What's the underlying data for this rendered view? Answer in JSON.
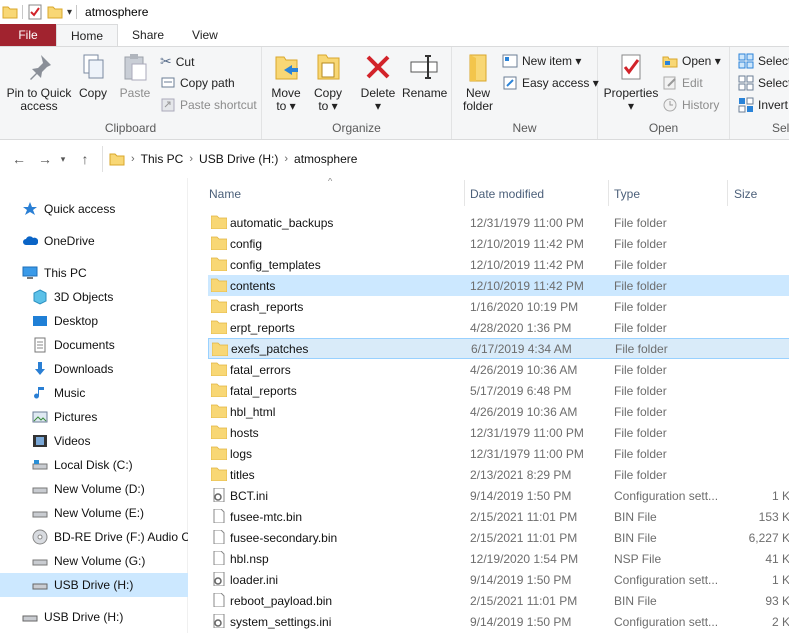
{
  "window": {
    "title": "atmosphere"
  },
  "tabs": [
    "File",
    "Home",
    "Share",
    "View"
  ],
  "ribbon": {
    "clipboard": {
      "label": "Clipboard",
      "pin": "Pin to Quick access",
      "pin_l1": "Pin to Quick",
      "pin_l2": "access",
      "copy": "Copy",
      "paste": "Paste",
      "cut": "Cut",
      "copy_path": "Copy path",
      "paste_shortcut": "Paste shortcut"
    },
    "organize": {
      "label": "Organize",
      "move_l1": "Move",
      "move_l2": "to ▾",
      "copy_l1": "Copy",
      "copy_l2": "to ▾",
      "delete_l1": "Delete",
      "delete_l2": "▾",
      "rename": "Rename"
    },
    "new": {
      "label": "New",
      "new_folder_l1": "New",
      "new_folder_l2": "folder",
      "new_item": "New item ▾",
      "easy_access": "Easy access ▾"
    },
    "open": {
      "label": "Open",
      "properties": "Properties",
      "properties_l2": "▾",
      "open": "Open ▾",
      "edit": "Edit",
      "history": "History"
    },
    "select": {
      "label": "Sel",
      "select_all": "Select",
      "select_none": "Select",
      "invert": "Invert"
    }
  },
  "address": {
    "breadcrumb": [
      "This PC",
      "USB Drive (H:)",
      "atmosphere"
    ]
  },
  "sidebar": {
    "items": [
      {
        "label": "Quick access",
        "icon": "star-icon"
      },
      {
        "label": "OneDrive",
        "icon": "cloud-icon"
      },
      {
        "label": "This PC",
        "icon": "computer-icon"
      },
      {
        "label": "3D Objects",
        "icon": "cube-icon"
      },
      {
        "label": "Desktop",
        "icon": "desktop-icon"
      },
      {
        "label": "Documents",
        "icon": "documents-icon"
      },
      {
        "label": "Downloads",
        "icon": "downloads-icon"
      },
      {
        "label": "Music",
        "icon": "music-icon"
      },
      {
        "label": "Pictures",
        "icon": "pictures-icon"
      },
      {
        "label": "Videos",
        "icon": "videos-icon"
      },
      {
        "label": "Local Disk (C:)",
        "icon": "drive-icon"
      },
      {
        "label": "New Volume (D:)",
        "icon": "drive-icon"
      },
      {
        "label": "New Volume (E:)",
        "icon": "drive-icon"
      },
      {
        "label": "BD-RE Drive (F:) Audio CD",
        "icon": "disc-icon"
      },
      {
        "label": "New Volume (G:)",
        "icon": "drive-icon"
      },
      {
        "label": "USB Drive (H:)",
        "icon": "usb-drive-icon"
      },
      {
        "label": "USB Drive (H:)",
        "icon": "usb-drive-icon"
      }
    ]
  },
  "columns": {
    "name": "Name",
    "date": "Date modified",
    "type": "Type",
    "size": "Size"
  },
  "files": [
    {
      "name": "automatic_backups",
      "date": "12/31/1979 11:00 PM",
      "type": "File folder",
      "size": "",
      "kind": "folder"
    },
    {
      "name": "config",
      "date": "12/10/2019 11:42 PM",
      "type": "File folder",
      "size": "",
      "kind": "folder"
    },
    {
      "name": "config_templates",
      "date": "12/10/2019 11:42 PM",
      "type": "File folder",
      "size": "",
      "kind": "folder"
    },
    {
      "name": "contents",
      "date": "12/10/2019 11:42 PM",
      "type": "File folder",
      "size": "",
      "kind": "folder"
    },
    {
      "name": "crash_reports",
      "date": "1/16/2020 10:19 PM",
      "type": "File folder",
      "size": "",
      "kind": "folder"
    },
    {
      "name": "erpt_reports",
      "date": "4/28/2020 1:36 PM",
      "type": "File folder",
      "size": "",
      "kind": "folder"
    },
    {
      "name": "exefs_patches",
      "date": "6/17/2019 4:34 AM",
      "type": "File folder",
      "size": "",
      "kind": "folder"
    },
    {
      "name": "fatal_errors",
      "date": "4/26/2019 10:36 AM",
      "type": "File folder",
      "size": "",
      "kind": "folder"
    },
    {
      "name": "fatal_reports",
      "date": "5/17/2019 6:48 PM",
      "type": "File folder",
      "size": "",
      "kind": "folder"
    },
    {
      "name": "hbl_html",
      "date": "4/26/2019 10:36 AM",
      "type": "File folder",
      "size": "",
      "kind": "folder"
    },
    {
      "name": "hosts",
      "date": "12/31/1979 11:00 PM",
      "type": "File folder",
      "size": "",
      "kind": "folder"
    },
    {
      "name": "logs",
      "date": "12/31/1979 11:00 PM",
      "type": "File folder",
      "size": "",
      "kind": "folder"
    },
    {
      "name": "titles",
      "date": "2/13/2021 8:29 PM",
      "type": "File folder",
      "size": "",
      "kind": "folder"
    },
    {
      "name": "BCT.ini",
      "date": "9/14/2019 1:50 PM",
      "type": "Configuration sett...",
      "size": "1 K",
      "kind": "ini"
    },
    {
      "name": "fusee-mtc.bin",
      "date": "2/15/2021 11:01 PM",
      "type": "BIN File",
      "size": "153 K",
      "kind": "file"
    },
    {
      "name": "fusee-secondary.bin",
      "date": "2/15/2021 11:01 PM",
      "type": "BIN File",
      "size": "6,227 K",
      "kind": "file"
    },
    {
      "name": "hbl.nsp",
      "date": "12/19/2020 1:54 PM",
      "type": "NSP File",
      "size": "41 K",
      "kind": "file"
    },
    {
      "name": "loader.ini",
      "date": "9/14/2019 1:50 PM",
      "type": "Configuration sett...",
      "size": "1 K",
      "kind": "ini"
    },
    {
      "name": "reboot_payload.bin",
      "date": "2/15/2021 11:01 PM",
      "type": "BIN File",
      "size": "93 K",
      "kind": "file"
    },
    {
      "name": "system_settings.ini",
      "date": "9/14/2019 1:50 PM",
      "type": "Configuration sett...",
      "size": "2 K",
      "kind": "ini"
    }
  ]
}
